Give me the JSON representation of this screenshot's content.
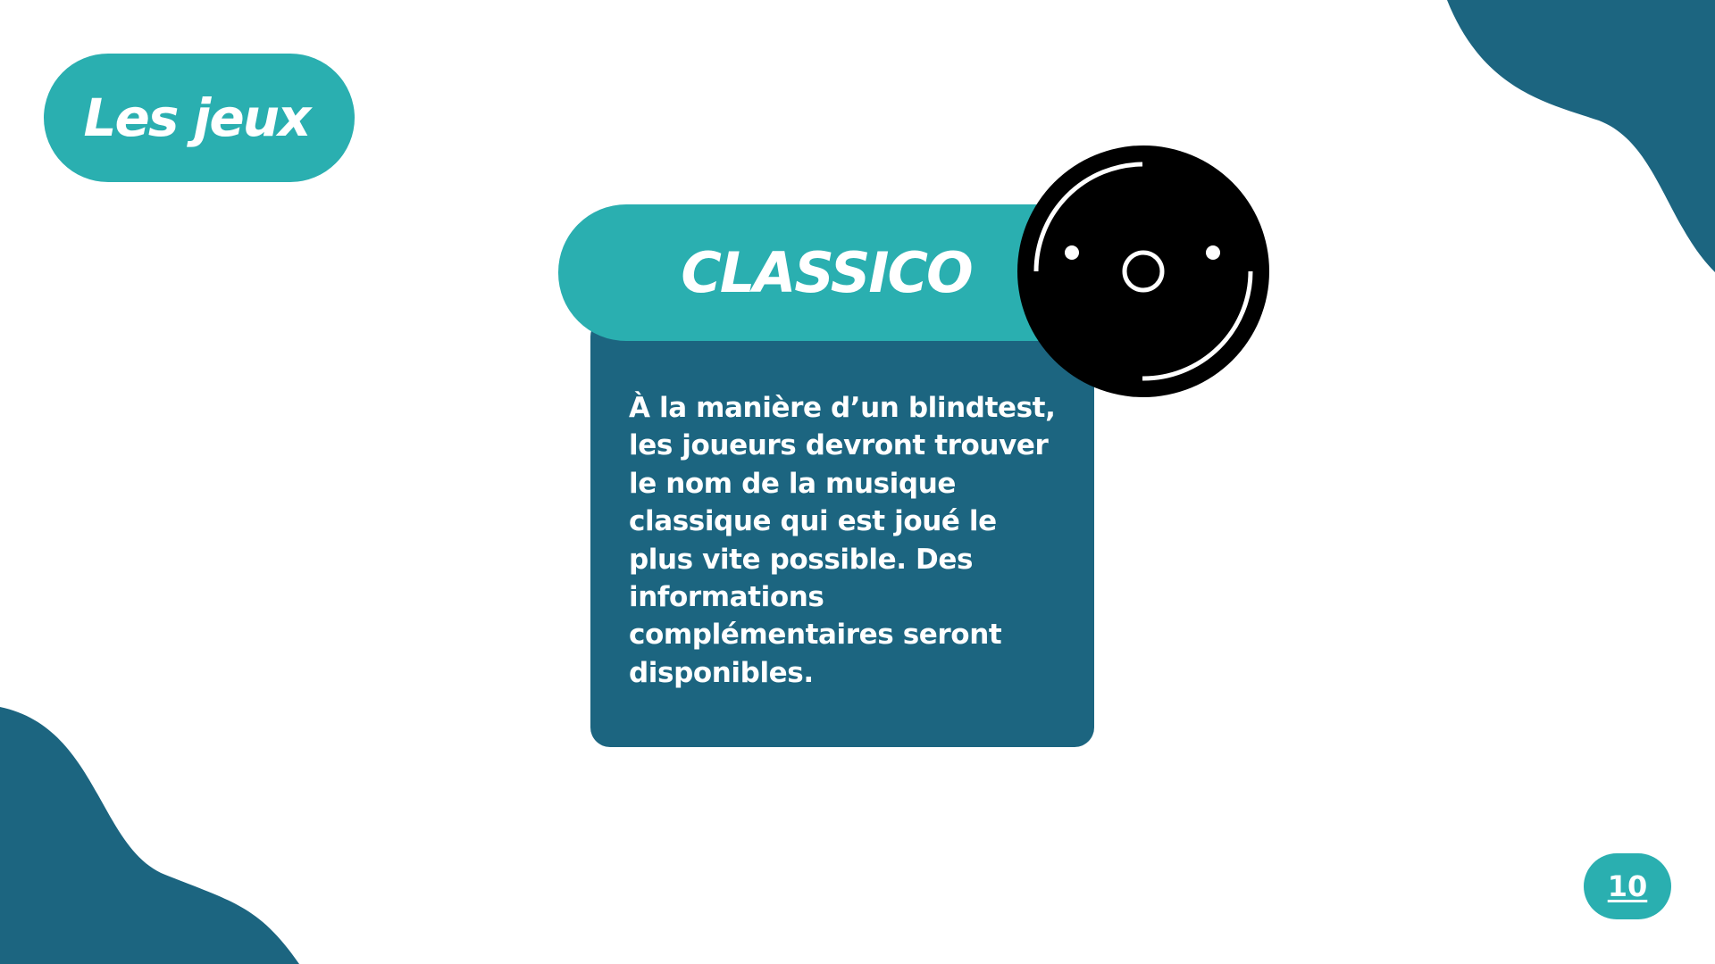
{
  "slide": {
    "section_title": "Les jeux",
    "page_number": "10"
  },
  "card": {
    "title": "CLASSICO",
    "description": "À la manière d’un blindtest, les joueurs devront trouver le nom de la musique classique qui est joué le plus vite possible. Des informations complémentaires seront disponibles."
  },
  "colors": {
    "teal": "#2aafb0",
    "dark_teal": "#1c6580",
    "background": "#ffffff",
    "vinyl": "#000000"
  },
  "icons": {
    "card": "vinyl-record-icon"
  }
}
